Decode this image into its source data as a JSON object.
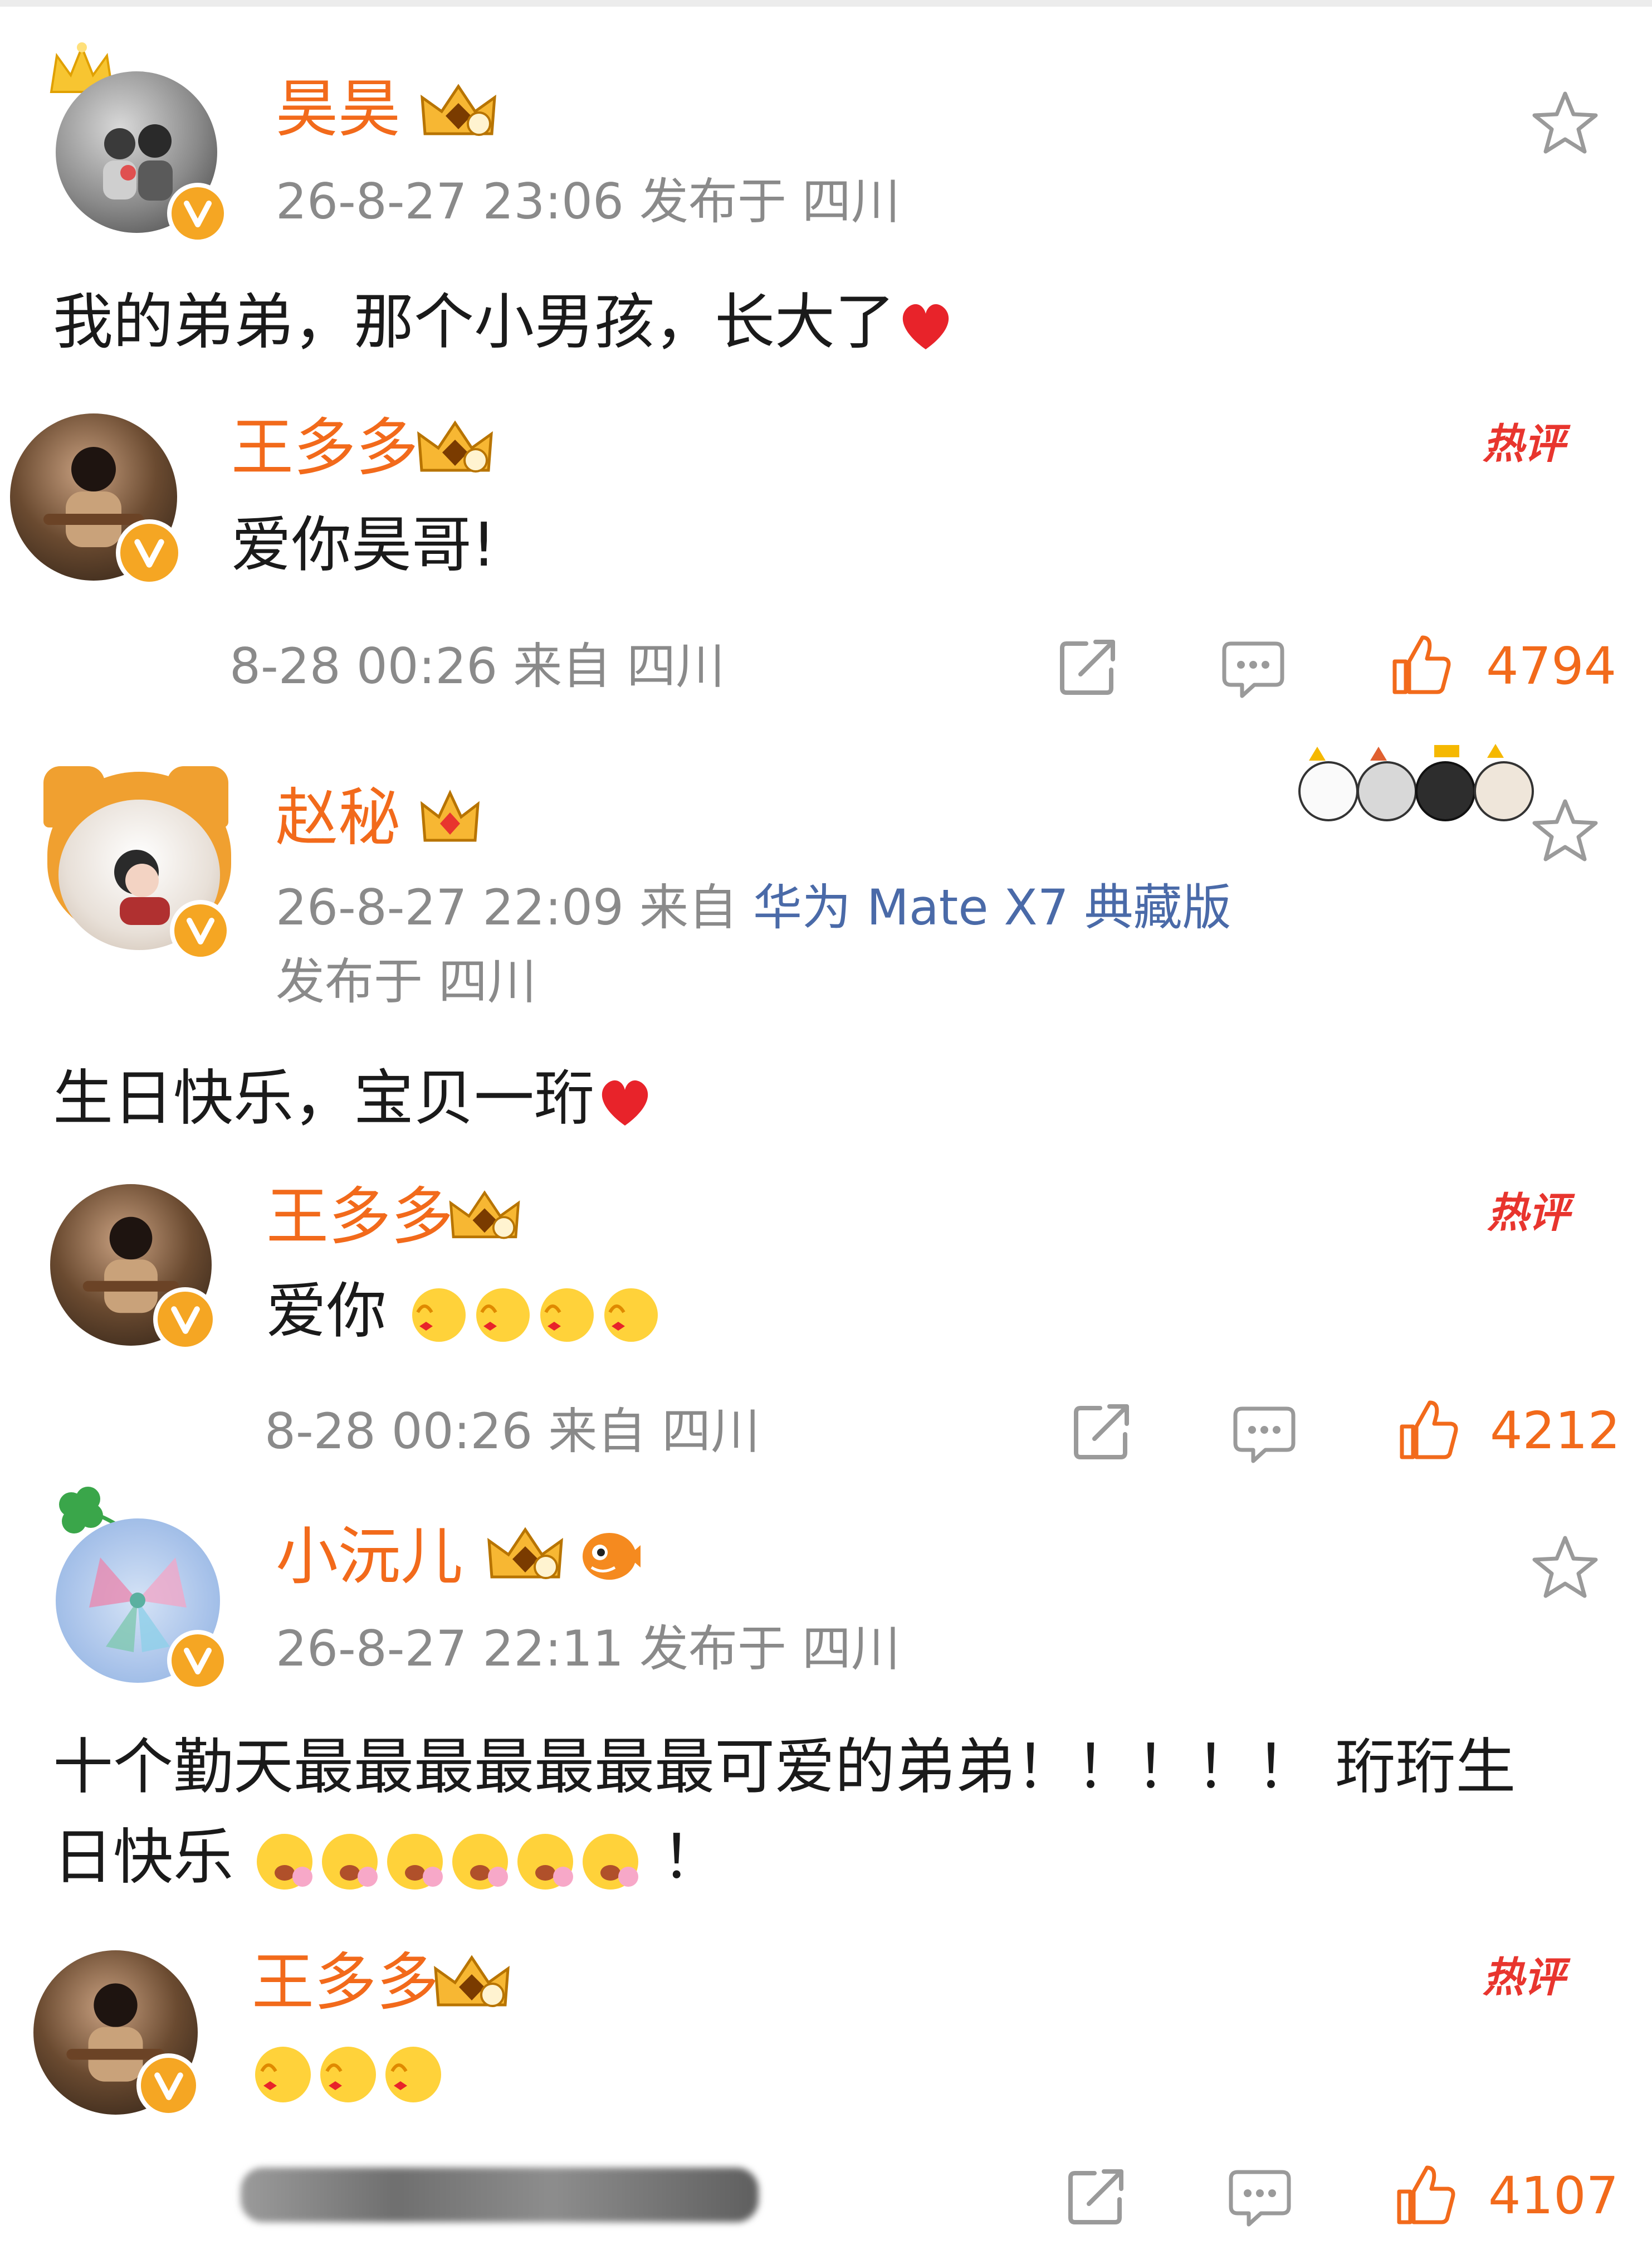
{
  "comments": [
    {
      "username": "昊昊",
      "meta": "26-8-27 23:06  发布于 四川",
      "text": "我的弟弟，那个小男孩，长大了",
      "reply": {
        "username": "王多多",
        "hot_label": "热评",
        "text": "爱你昊哥!",
        "meta": "8-28 00:26  来自 四川",
        "likes": "4794"
      }
    },
    {
      "username": "赵秘",
      "meta_time": "26-8-27 22:09  来自 ",
      "meta_device": "华为 Mate X7 典藏版",
      "meta_line2": "发布于 四川",
      "text": "生日快乐，宝贝一珩",
      "reply": {
        "username": "王多多",
        "hot_label": "热评",
        "text": "爱你",
        "meta": "8-28 00:26  来自 四川",
        "likes": "4212"
      }
    },
    {
      "username": "小沅儿",
      "meta": "26-8-27 22:11  发布于 四川",
      "text_line1": "十个勤天最最最最最最最可爱的弟弟！！！！！ 珩珩生",
      "text_line2": "日快乐",
      "text_line2_end": "！",
      "reply": {
        "username": "王多多",
        "hot_label": "热评",
        "likes": "4107"
      }
    }
  ],
  "icons": {
    "star": "star-outline-icon",
    "share": "share-icon",
    "comment": "comment-icon",
    "like": "thumbs-up-icon",
    "crown": "crown-badge-icon",
    "verified": "verified-v-icon"
  },
  "colors": {
    "username": "#f26a1b",
    "meta": "#8a8a8a",
    "device": "#4a6aa8",
    "hot": "#e8352e",
    "like": "#f26a1b",
    "icon": "#9a9a9a"
  }
}
